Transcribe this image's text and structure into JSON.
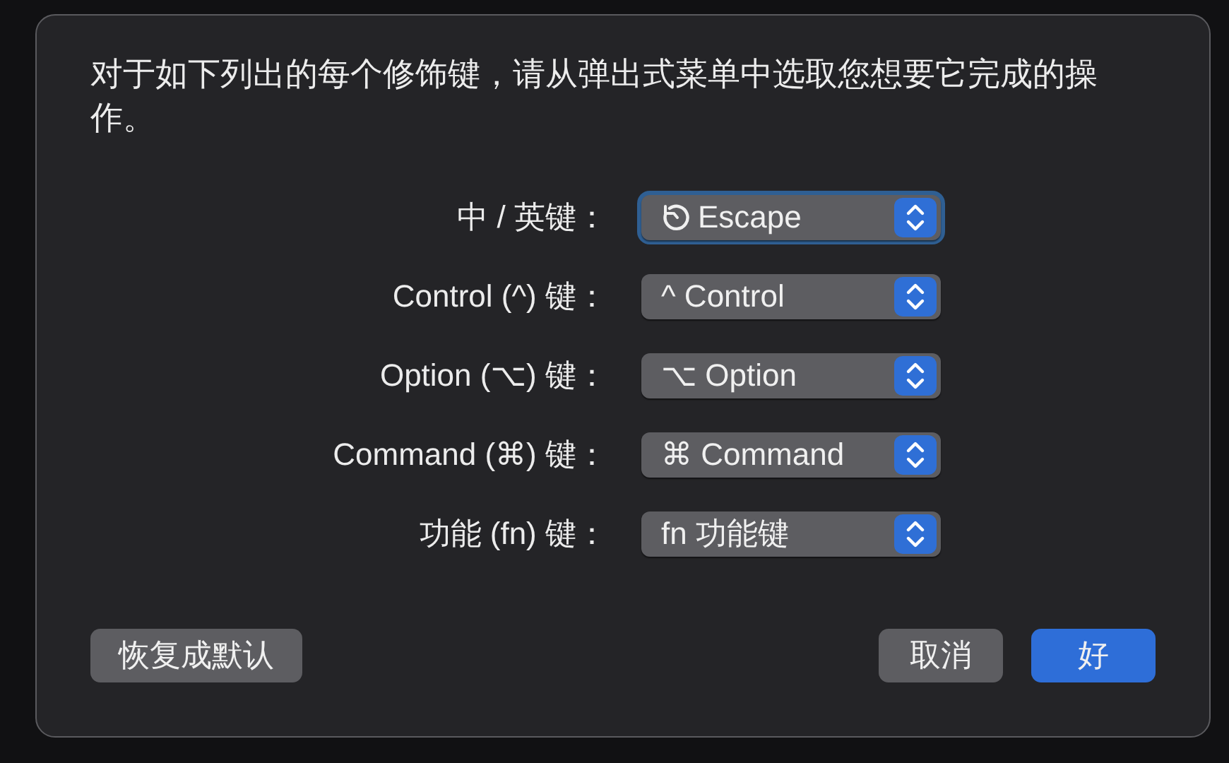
{
  "dialog": {
    "description": "对于如下列出的每个修饰键，请从弹出式菜单中选取您想要它完成的操作。",
    "rows": [
      {
        "label": "中 / 英键：",
        "value": "Escape",
        "kind": "icon-value",
        "focused": true
      },
      {
        "label": "Control (^) 键：",
        "value": "^ Control",
        "kind": "text-value",
        "focused": false
      },
      {
        "label": "Option (⌥) 键：",
        "value": "⌥ Option",
        "kind": "text-value",
        "focused": false
      },
      {
        "label": "Command (⌘) 键：",
        "value": "⌘ Command",
        "kind": "text-value",
        "focused": false
      },
      {
        "label": "功能 (fn) 键：",
        "value": "fn 功能键",
        "kind": "text-value",
        "focused": false
      }
    ],
    "buttons": [
      {
        "label": "恢复成默认",
        "default": false,
        "kind": "restore"
      },
      {
        "label": "取消",
        "default": false,
        "kind": "cancel"
      },
      {
        "label": "好",
        "default": true,
        "kind": "ok"
      }
    ]
  }
}
